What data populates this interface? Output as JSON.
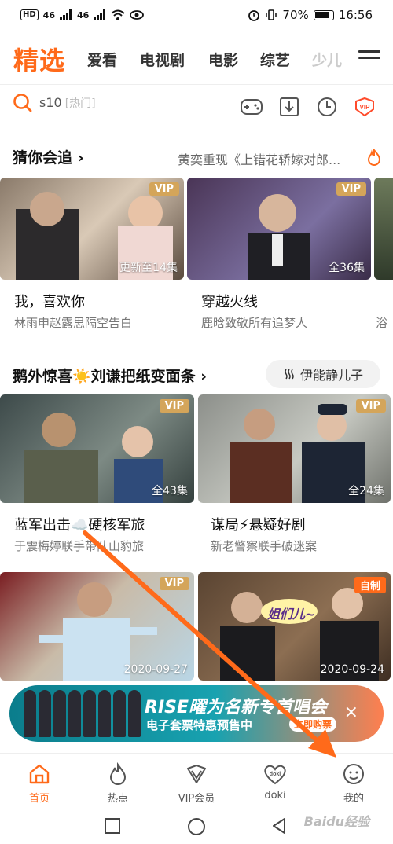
{
  "status_bar": {
    "chip": "HD",
    "net1": "46",
    "net2": "46",
    "battery": "70%",
    "time": "16:56"
  },
  "colors": {
    "accent": "#ff6a1a",
    "vip_badge": "#d4a55a"
  },
  "top_nav": {
    "tabs": [
      {
        "label": "精选",
        "active": true
      },
      {
        "label": "爱看"
      },
      {
        "label": "电视剧"
      },
      {
        "label": "电影"
      },
      {
        "label": "综艺"
      },
      {
        "label": "少儿"
      }
    ]
  },
  "search": {
    "query": "s10",
    "hint": "[热门]"
  },
  "section1": {
    "title": "猜你会追",
    "hot_text": "黄奕重现《上错花轿嫁对郎...",
    "cards": [
      {
        "badge": "VIP",
        "episodes": "更新至14集",
        "title": "我，喜欢你",
        "subtitle": "林雨申赵露思隔空告白"
      },
      {
        "badge": "VIP",
        "episodes": "全36集",
        "title": "穿越火线",
        "subtitle": "鹿晗致敬所有追梦人"
      },
      {
        "badge": "",
        "episodes": "",
        "title": "",
        "subtitle": "浴"
      }
    ]
  },
  "section2": {
    "title": "鹅外惊喜☀️刘谦把纸变面条",
    "pill": "伊能静儿子",
    "cards": [
      {
        "badge": "VIP",
        "episodes": "全43集",
        "title": "蓝军出击☁️硬核军旅",
        "subtitle": "于震梅婷联手带队山豹旅"
      },
      {
        "badge": "VIP",
        "episodes": "全24集",
        "title": "谋局⚡悬疑好剧",
        "subtitle": "新老警察联手破迷案"
      },
      {
        "badge": "VIP",
        "episodes": "2020-09-27",
        "title": "",
        "subtitle": ""
      },
      {
        "badge": "自制",
        "episodes": "2020-09-24",
        "speech": "姐们儿~",
        "title": "",
        "subtitle": ""
      }
    ]
  },
  "banner": {
    "title": "RISE曜为名新专首唱会",
    "subtitle": "电子套票特惠预售中",
    "button": "立即购票",
    "close": "×"
  },
  "bottom_tabs": [
    {
      "label": "首页",
      "icon": "home-icon",
      "active": true
    },
    {
      "label": "热点",
      "icon": "flame-icon"
    },
    {
      "label": "VIP会员",
      "icon": "vip-crown-icon"
    },
    {
      "label": "doki",
      "icon": "doki-heart-icon"
    },
    {
      "label": "我的",
      "icon": "smiley-profile-icon"
    }
  ],
  "watermark": "Baidu经验"
}
